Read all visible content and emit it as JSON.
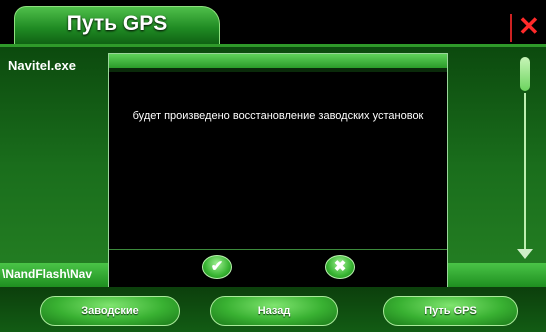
{
  "window": {
    "title": "Путь GPS",
    "close_symbol": "✕"
  },
  "file_list": {
    "items": [
      "Navitel.exe"
    ]
  },
  "path_bar": {
    "text": "\\NandFlash\\Nav"
  },
  "dialog": {
    "message": "будет произведено восстановление заводских установок",
    "ok_symbol": "✔",
    "cancel_symbol": "✖"
  },
  "toolbar": {
    "buttons": [
      "Заводские",
      "Назад",
      "Путь GPS"
    ]
  },
  "icons": {
    "close": "close-icon",
    "ok": "check-icon",
    "cancel": "cross-icon",
    "scroll_down": "arrow-down-icon"
  },
  "colors": {
    "accent_green": "#2f9a2a",
    "close_red": "#ff2a2a",
    "background": "#000000"
  }
}
